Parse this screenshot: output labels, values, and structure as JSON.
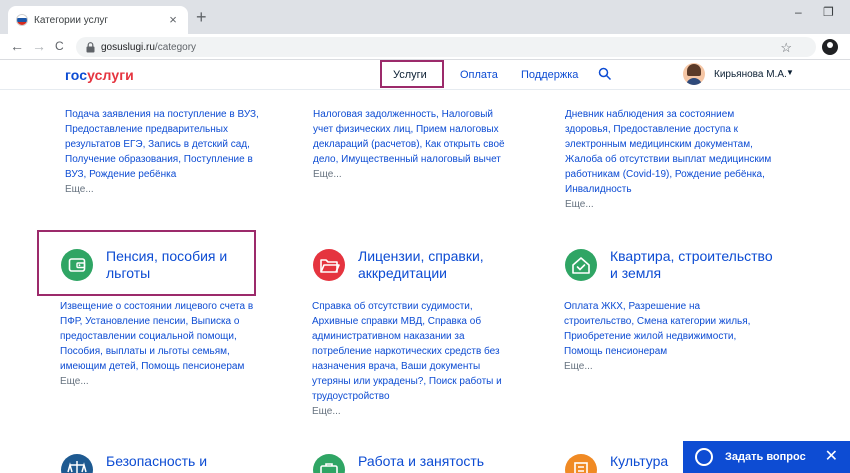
{
  "browser": {
    "tab_title": "Категории услуг",
    "tab_close": "×",
    "new_tab": "+",
    "url_host": "gosuslugi.ru",
    "url_path": "/category",
    "controls": {
      "minimize": "–",
      "maximize": "❐"
    },
    "nav": {
      "back": "←",
      "forward": "→",
      "reload": "C"
    },
    "star": "☆"
  },
  "header": {
    "logo_part1": "гос",
    "logo_part2": "услуги",
    "nav": [
      "Услуги",
      "Оплата",
      "Поддержка"
    ],
    "user_name": "Кирьянова М.А.",
    "user_caret": "▼"
  },
  "columns_top": [
    {
      "text": "Подача заявления на поступление в ВУЗ, Предоставление предварительных результатов ЕГЭ, Запись в детский сад, Получение образования, Поступление в ВУЗ, Рождение ребёнка",
      "more": "Еще..."
    },
    {
      "text": "Налоговая задолженность, Налоговый учет физических лиц, Прием налоговых деклараций (расчетов), Как открыть своё дело, Имущественный налоговый вычет",
      "more": "Еще..."
    },
    {
      "text": "Дневник наблюдения за состоянием здоровья, Предоставление доступа к электронным медицинским документам, Жалоба об отсутствии выплат медицинским работникам (Covid-19), Рождение ребёнка, Инвалидность",
      "more": "Еще..."
    }
  ],
  "categories_mid": [
    {
      "title": "Пенсия, пособия и льготы",
      "icon": "wallet-icon",
      "color": "#2fa564",
      "text": "Извещение о состоянии лицевого счета в ПФР, Установление пенсии, Выписка о предоставлении социальной помощи, Пособия, выплаты и льготы семьям, имеющим детей, Помощь пенсионерам",
      "more": "Еще..."
    },
    {
      "title": "Лицензии, справки, аккредитации",
      "icon": "folder-icon",
      "color": "#e5343f",
      "text": "Справка об отсутствии судимости, Архивные справки МВД, Справка об административном наказании за потребление наркотических средств без назначения врача, Ваши документы утеряны или украдены?, Поиск работы и трудоустройство",
      "more": "Еще..."
    },
    {
      "title": "Квартира, строительство и земля",
      "icon": "house-icon",
      "color": "#2fa564",
      "text": "Оплата ЖКХ, Разрешение на строительство, Смена категории жилья, Приобретение жилой недвижимости, Помощь пенсионерам",
      "more": "Еще..."
    }
  ],
  "categories_bottom": [
    {
      "title": "Безопасность и",
      "icon": "scales-icon",
      "color": "#1e5a91"
    },
    {
      "title": "Работа и занятость",
      "icon": "briefcase-icon",
      "color": "#2fa564"
    },
    {
      "title": "Культура",
      "icon": "building-icon",
      "color": "#f08a24"
    }
  ],
  "chat": {
    "label": "Задать вопрос",
    "close": "✕"
  }
}
